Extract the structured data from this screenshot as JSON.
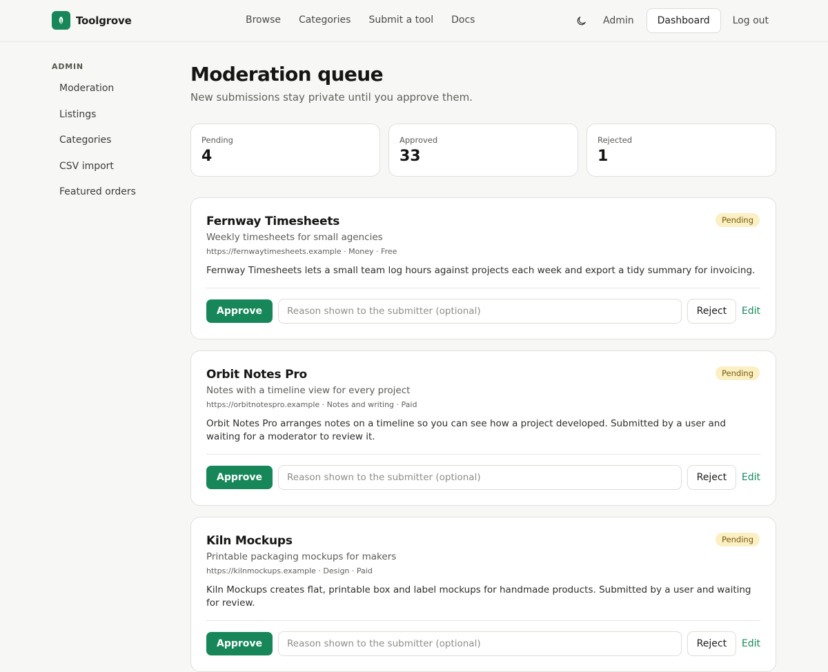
{
  "brand": {
    "name": "Toolgrove",
    "accent": "#17875a"
  },
  "nav": {
    "items": [
      "Browse",
      "Categories",
      "Submit a tool",
      "Docs"
    ]
  },
  "header_right": {
    "theme_icon": "moon-icon",
    "admin": "Admin",
    "dashboard": "Dashboard",
    "logout": "Log out"
  },
  "sidebar": {
    "heading": "ADMIN",
    "items": [
      "Moderation",
      "Listings",
      "Categories",
      "CSV import",
      "Featured orders"
    ]
  },
  "page": {
    "title": "Moderation queue",
    "subtitle": "New submissions stay private until you approve them."
  },
  "stats": [
    {
      "label": "Pending",
      "value": "4"
    },
    {
      "label": "Approved",
      "value": "33"
    },
    {
      "label": "Rejected",
      "value": "1"
    }
  ],
  "actions": {
    "approve": "Approve",
    "reason_placeholder": "Reason shown to the submitter (optional)",
    "reject": "Reject",
    "edit": "Edit"
  },
  "submissions": [
    {
      "title": "Fernway Timesheets",
      "tagline": "Weekly timesheets for small agencies",
      "meta": "https://fernwaytimesheets.example · Money · Free",
      "description": "Fernway Timesheets lets a small team log hours against projects each week and export a tidy summary for invoicing.",
      "status": "Pending"
    },
    {
      "title": "Orbit Notes Pro",
      "tagline": "Notes with a timeline view for every project",
      "meta": "https://orbitnotespro.example · Notes and writing · Paid",
      "description": "Orbit Notes Pro arranges notes on a timeline so you can see how a project developed. Submitted by a user and waiting for a moderator to review it.",
      "status": "Pending"
    },
    {
      "title": "Kiln Mockups",
      "tagline": "Printable packaging mockups for makers",
      "meta": "https://kilnmockups.example · Design · Paid",
      "description": "Kiln Mockups creates flat, printable box and label mockups for handmade products. Submitted by a user and waiting for review.",
      "status": "Pending"
    }
  ]
}
